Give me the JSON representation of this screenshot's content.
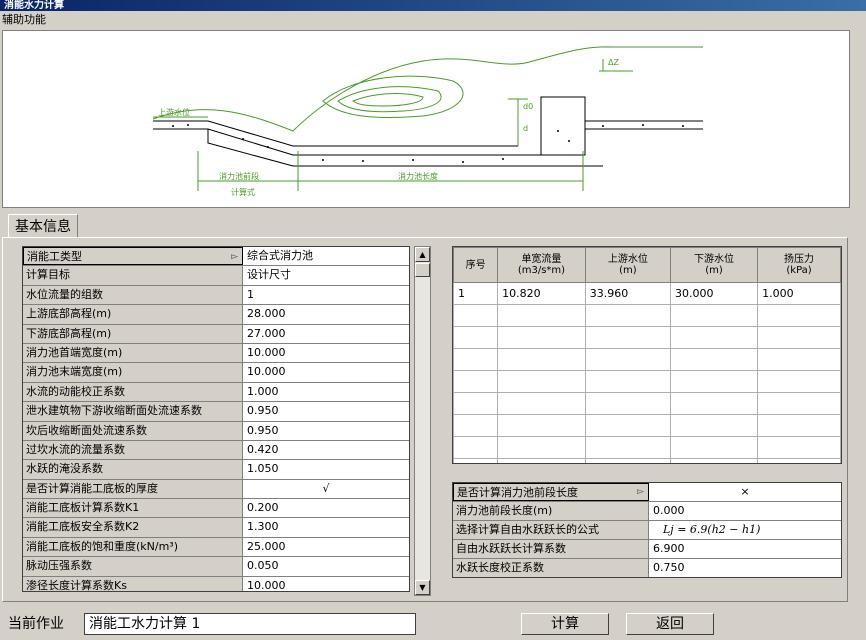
{
  "window": {
    "title": "消能水力计算"
  },
  "menu": {
    "items": [
      "辅助功能"
    ]
  },
  "diagram": {
    "labels": {
      "upstream": "上游水位",
      "pool_length": "消力池长度",
      "front_length": "消力池前段",
      "dz": "ΔZ",
      "d0": "d0",
      "d": "d",
      "calc": "计算式"
    }
  },
  "tabs": [
    {
      "label": "基本信息"
    }
  ],
  "params": [
    {
      "key": "消能工类型",
      "value": "综合式消力池",
      "dropdown": true,
      "selected": true
    },
    {
      "key": "计算目标",
      "value": "设计尺寸"
    },
    {
      "key": "水位流量的组数",
      "value": "1"
    },
    {
      "key": "上游底部高程(m)",
      "value": "28.000"
    },
    {
      "key": "下游底部高程(m)",
      "value": "27.000"
    },
    {
      "key": "消力池首端宽度(m)",
      "value": "10.000"
    },
    {
      "key": "消力池末端宽度(m)",
      "value": "10.000"
    },
    {
      "key": "水流的动能校正系数",
      "value": "1.000"
    },
    {
      "key": "泄水建筑物下游收缩断面处流速系数",
      "value": "0.950"
    },
    {
      "key": "坎后收缩断面处流速系数",
      "value": "0.950"
    },
    {
      "key": "过坎水流的流量系数",
      "value": "0.420"
    },
    {
      "key": "水跃的淹没系数",
      "value": "1.050"
    },
    {
      "key": "是否计算消能工底板的厚度",
      "value": "√",
      "center": true
    },
    {
      "key": "消能工底板计算系数K1",
      "value": "0.200"
    },
    {
      "key": "消能工底板安全系数K2",
      "value": "1.300"
    },
    {
      "key": "消能工底板的饱和重度(kN/m³)",
      "value": "25.000"
    },
    {
      "key": "脉动压强系数",
      "value": "0.050"
    },
    {
      "key": "渗径长度计算系数Ks",
      "value": "10.000"
    }
  ],
  "flow_table": {
    "headers": [
      {
        "line1": "序号",
        "line2": ""
      },
      {
        "line1": "单宽流量",
        "line2": "(m3/s*m)"
      },
      {
        "line1": "上游水位",
        "line2": "(m)"
      },
      {
        "line1": "下游水位",
        "line2": "(m)"
      },
      {
        "line1": "扬压力",
        "line2": "(kPa)"
      }
    ],
    "rows": [
      [
        "1",
        "10.820",
        "33.960",
        "30.000",
        "1.000"
      ]
    ]
  },
  "front_params": [
    {
      "key": "是否计算消力池前段长度",
      "value": "×",
      "dropdown": true,
      "selected": true,
      "center": true
    },
    {
      "key": "消力池前段长度(m)",
      "value": "0.000"
    },
    {
      "key": "选择计算自由水跃跃长的公式",
      "value": "Lj = 6.9(h2 − h1)",
      "formula": true
    },
    {
      "key": "自由水跃跃长计算系数",
      "value": "6.900"
    },
    {
      "key": "水跃长度校正系数",
      "value": "0.750"
    }
  ],
  "footer": {
    "current_label": "当前作业",
    "current_value": "消能工水力计算 1",
    "calc_button": "计算",
    "back_button": "返回"
  }
}
